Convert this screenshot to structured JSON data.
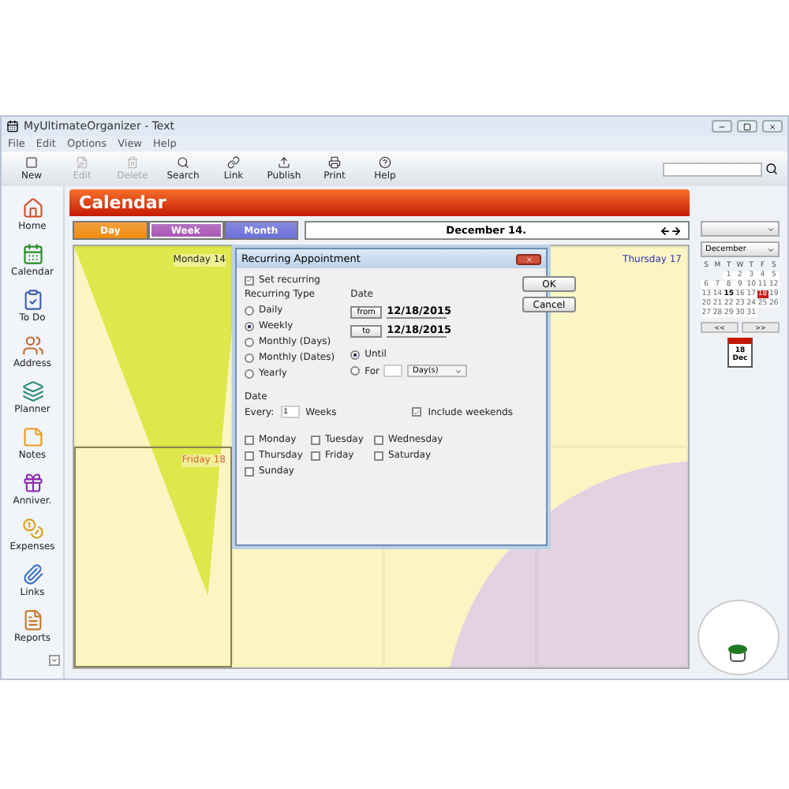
{
  "window": {
    "title": "MyUltimateOrganizer - Text"
  },
  "menu": [
    "File",
    "Edit",
    "Options",
    "View",
    "Help"
  ],
  "toolbar": [
    {
      "label": "New",
      "kind": "new",
      "disabled": false
    },
    {
      "label": "Edit",
      "kind": "edit",
      "disabled": true
    },
    {
      "label": "Delete",
      "kind": "delete",
      "disabled": true
    },
    {
      "label": "Search",
      "kind": "search",
      "disabled": false
    },
    {
      "label": "Link",
      "kind": "link",
      "disabled": false
    },
    {
      "label": "Publish",
      "kind": "publish",
      "disabled": false
    },
    {
      "label": "Print",
      "kind": "print",
      "disabled": false
    },
    {
      "label": "Help",
      "kind": "help",
      "disabled": false
    }
  ],
  "sidebar": {
    "items": [
      {
        "label": "Home",
        "kind": "home"
      },
      {
        "label": "Calendar",
        "kind": "calendar"
      },
      {
        "label": "To Do",
        "kind": "todo"
      },
      {
        "label": "Address",
        "kind": "address"
      },
      {
        "label": "Planner",
        "kind": "planner"
      },
      {
        "label": "Notes",
        "kind": "notes"
      },
      {
        "label": "Anniver.",
        "kind": "anniversary"
      },
      {
        "label": "Expenses",
        "kind": "expenses"
      },
      {
        "label": "Links",
        "kind": "links"
      },
      {
        "label": "Reports",
        "kind": "reports"
      }
    ]
  },
  "header": {
    "title": "Calendar"
  },
  "tabs": [
    {
      "label": "Day",
      "color": "#f08c10",
      "selected": false
    },
    {
      "label": "Week",
      "color": "#a855b5",
      "selected": true
    },
    {
      "label": "Month",
      "color": "#6c6fd8",
      "selected": false
    }
  ],
  "date_bar": {
    "label": "December 14."
  },
  "calendar": {
    "cells": [
      {
        "label": "Monday 14",
        "selected": false
      },
      {
        "label": "Thursday 17",
        "selected": false
      },
      {
        "label": "Friday 18",
        "selected": true
      },
      {
        "selected": false
      },
      {
        "selected": false
      },
      {
        "selected": false
      }
    ]
  },
  "dialog": {
    "title": "Recurring Appointment",
    "set_recurring": {
      "label": "Set recurring",
      "checked": true
    },
    "type_group": {
      "title": "Recurring Type",
      "options": [
        {
          "label": "Daily",
          "selected": false
        },
        {
          "label": "Weekly",
          "selected": true
        },
        {
          "label": "Monthly (Days)",
          "selected": false
        },
        {
          "label": "Monthly (Dates)",
          "selected": false
        },
        {
          "label": "Yearly",
          "selected": false
        }
      ]
    },
    "date_group": {
      "title": "Date",
      "from": {
        "button": "from",
        "value": "12/18/2015"
      },
      "to": {
        "button": "to",
        "value": "12/18/2015"
      },
      "until": {
        "label": "Until",
        "selected": true
      },
      "for": {
        "label": "For",
        "selected": false,
        "unit": "Day(s)"
      }
    },
    "every": {
      "title": "Date",
      "label": "Every:",
      "value": "1",
      "unit": "Weeks",
      "include_weekends": {
        "label": "Include weekends",
        "checked": true
      }
    },
    "days": [
      {
        "label": "Monday",
        "checked": false
      },
      {
        "label": "Tuesday",
        "checked": false
      },
      {
        "label": "Wednesday",
        "checked": false
      },
      {
        "label": "Thursday",
        "checked": false
      },
      {
        "label": "Friday",
        "checked": false
      },
      {
        "label": "Saturday",
        "checked": false
      },
      {
        "label": "Sunday",
        "checked": false
      }
    ],
    "buttons": [
      "OK",
      "Cancel"
    ]
  },
  "side_panel": {
    "month": "December",
    "weekdays": [
      "S",
      "M",
      "T",
      "W",
      "T",
      "F",
      "S"
    ],
    "days": [
      {
        "d": "1",
        "today": false,
        "selected": false
      },
      {
        "d": "2",
        "today": false,
        "selected": false
      },
      {
        "d": "3",
        "today": false,
        "selected": false
      },
      {
        "d": "4",
        "today": false,
        "selected": false
      },
      {
        "d": "5",
        "today": false,
        "selected": false
      },
      {
        "d": "6",
        "today": false,
        "selected": false
      },
      {
        "d": "7",
        "today": false,
        "selected": false
      },
      {
        "d": "8",
        "today": false,
        "selected": false
      },
      {
        "d": "9",
        "today": false,
        "selected": false
      },
      {
        "d": "10",
        "today": false,
        "selected": false
      },
      {
        "d": "11",
        "today": false,
        "selected": false
      },
      {
        "d": "12",
        "today": false,
        "selected": false
      },
      {
        "d": "13",
        "today": false,
        "selected": false
      },
      {
        "d": "14",
        "today": false,
        "selected": false
      },
      {
        "d": "15",
        "today": true,
        "selected": false
      },
      {
        "d": "16",
        "today": false,
        "selected": false
      },
      {
        "d": "17",
        "today": false,
        "selected": false
      },
      {
        "d": "18",
        "today": false,
        "selected": true
      },
      {
        "d": "19",
        "today": false,
        "selected": false
      },
      {
        "d": "20",
        "today": false,
        "selected": false
      },
      {
        "d": "21",
        "today": false,
        "selected": false
      },
      {
        "d": "22",
        "today": false,
        "selected": false
      },
      {
        "d": "23",
        "today": false,
        "selected": false
      },
      {
        "d": "24",
        "today": false,
        "selected": false
      },
      {
        "d": "25",
        "today": false,
        "selected": false
      },
      {
        "d": "26",
        "today": false,
        "selected": false
      },
      {
        "d": "27",
        "today": false,
        "selected": false
      },
      {
        "d": "28",
        "today": false,
        "selected": false
      },
      {
        "d": "29",
        "today": false,
        "selected": false
      },
      {
        "d": "30",
        "today": false,
        "selected": false
      },
      {
        "d": "31",
        "today": false,
        "selected": false
      }
    ],
    "nav": [
      "<<",
      ">>"
    ],
    "date_icon": {
      "day": "18",
      "month": "Dec"
    }
  }
}
